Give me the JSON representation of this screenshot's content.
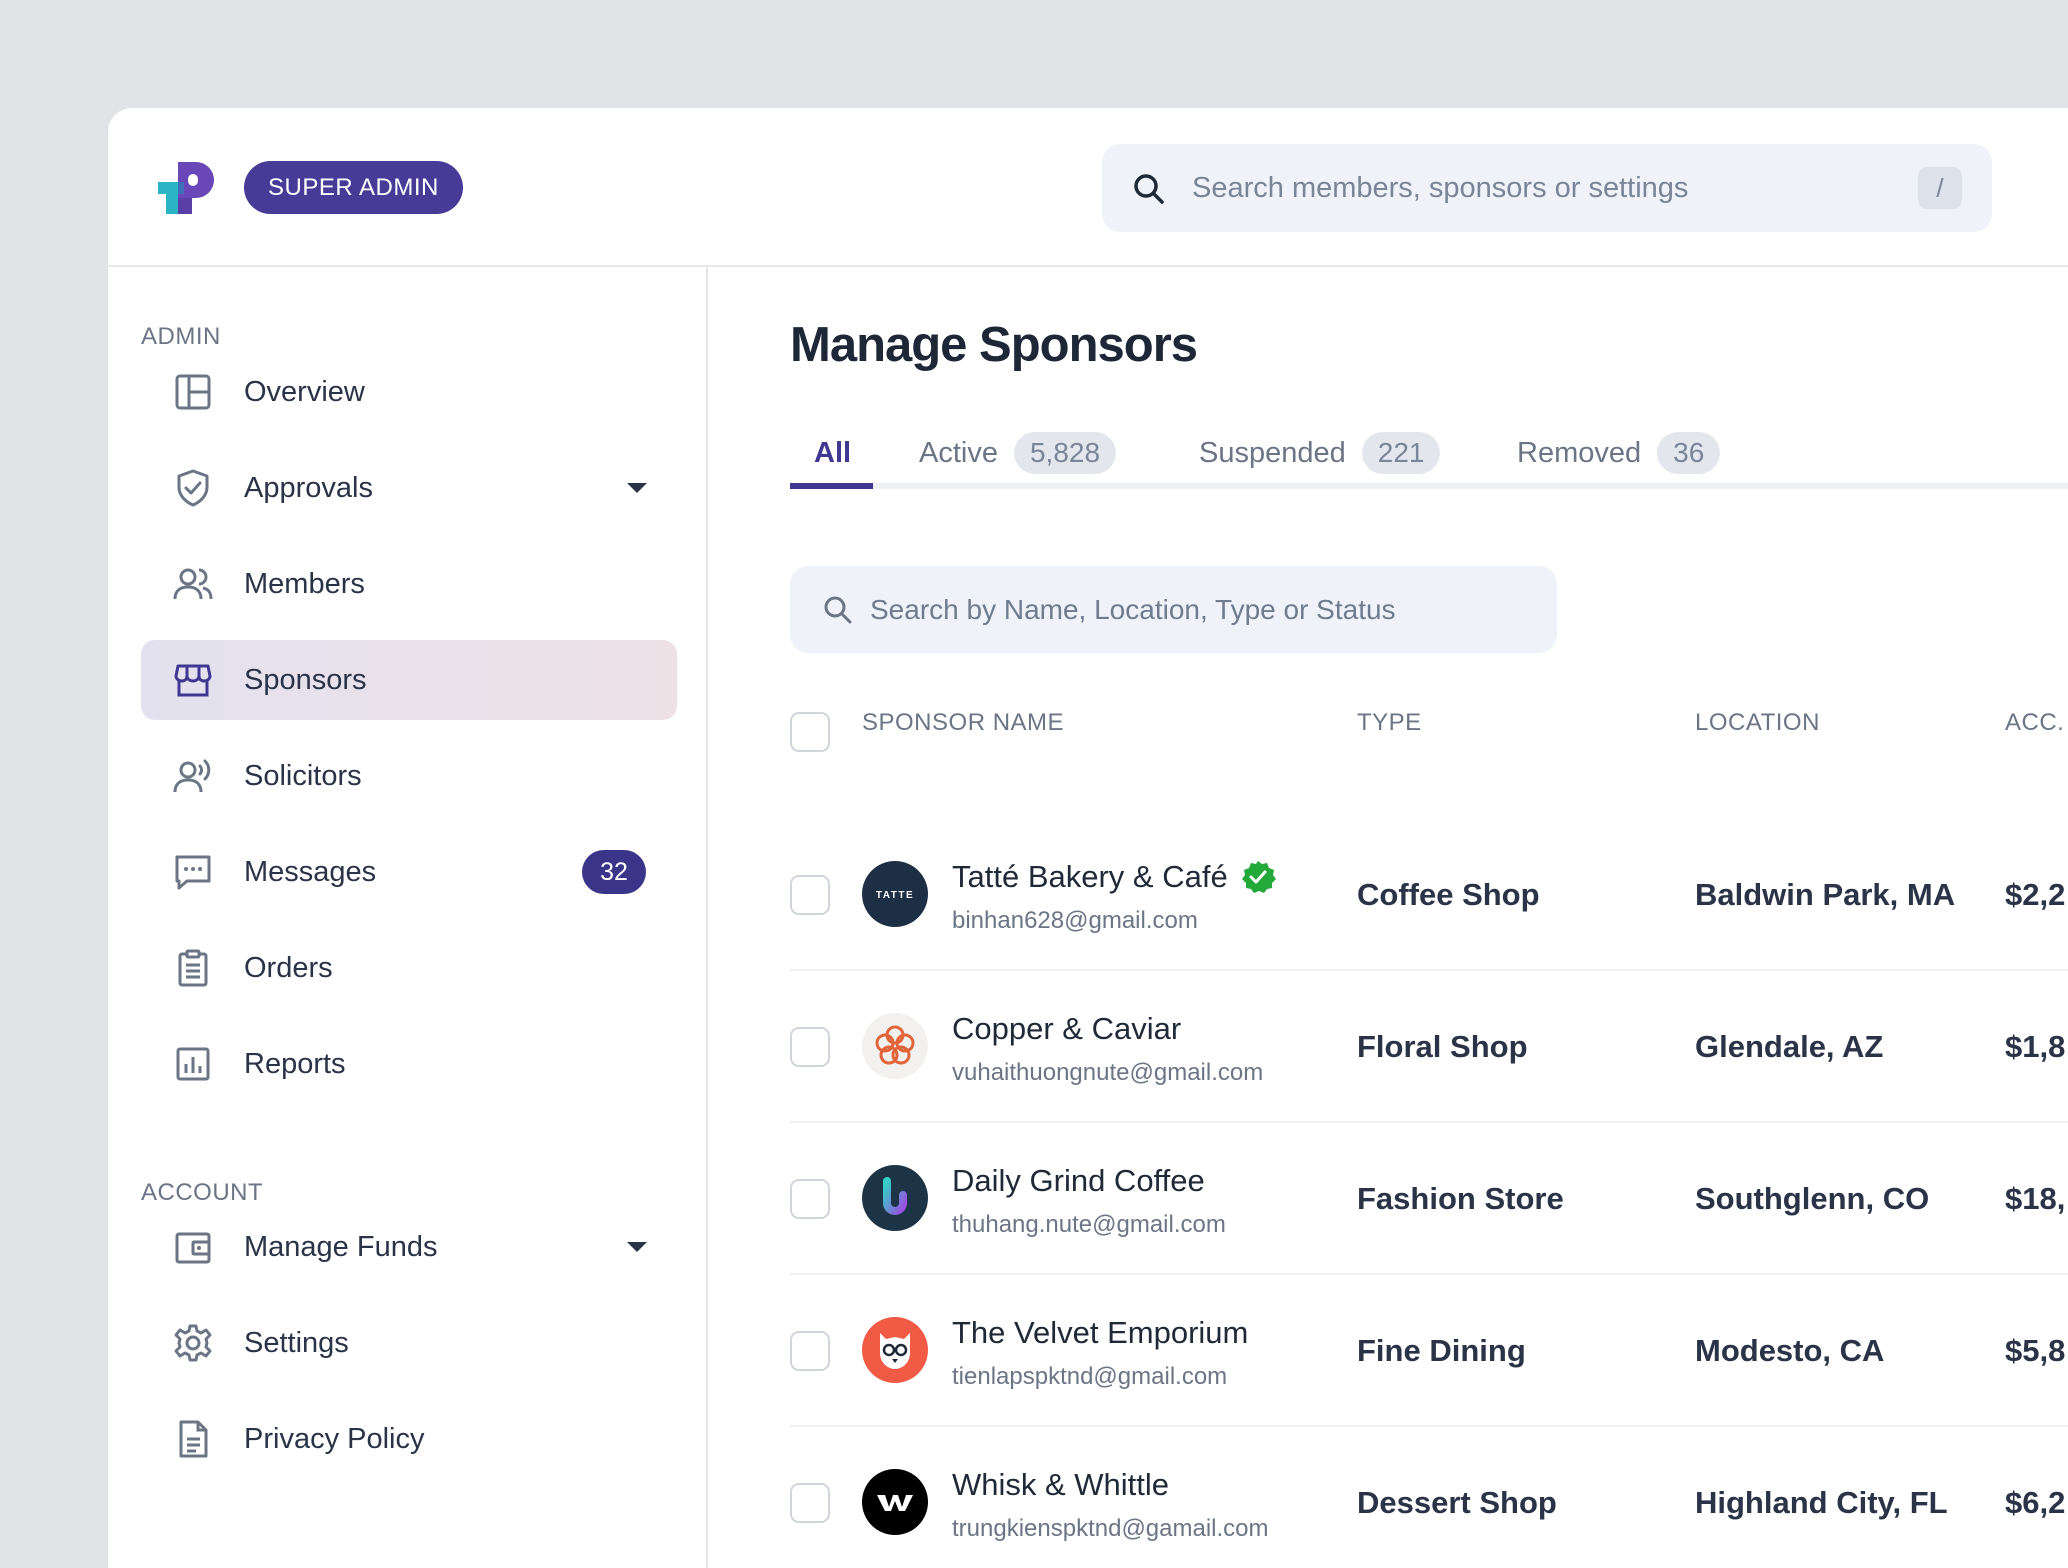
{
  "header": {
    "role_badge": "SUPER ADMIN",
    "search_placeholder": "Search members, sponsors or settings",
    "search_shortcut": "/"
  },
  "sidebar": {
    "admin_label": "ADMIN",
    "account_label": "ACCOUNT",
    "admin_items": [
      {
        "label": "Overview",
        "icon": "layout-icon"
      },
      {
        "label": "Approvals",
        "icon": "shield-check-icon"
      },
      {
        "label": "Members",
        "icon": "users-icon"
      },
      {
        "label": "Sponsors",
        "icon": "storefront-icon"
      },
      {
        "label": "Solicitors",
        "icon": "user-broadcast-icon"
      },
      {
        "label": "Messages",
        "icon": "message-icon",
        "badge": "32"
      },
      {
        "label": "Orders",
        "icon": "clipboard-icon"
      },
      {
        "label": "Reports",
        "icon": "bar-chart-icon"
      }
    ],
    "account_items": [
      {
        "label": "Manage Funds",
        "icon": "wallet-icon"
      },
      {
        "label": "Settings",
        "icon": "gear-icon"
      },
      {
        "label": "Privacy Policy",
        "icon": "document-icon"
      }
    ]
  },
  "main": {
    "title": "Manage Sponsors",
    "tabs": [
      {
        "label": "All"
      },
      {
        "label": "Active",
        "count": "5,828"
      },
      {
        "label": "Suspended",
        "count": "221"
      },
      {
        "label": "Removed",
        "count": "36"
      }
    ],
    "table_search_placeholder": "Search by Name, Location, Type or Status",
    "columns": [
      "SPONSOR NAME",
      "TYPE",
      "LOCATION",
      "ACC."
    ],
    "rows": [
      {
        "name": "Tatté Bakery & Café",
        "email": "binhan628@gmail.com",
        "type": "Coffee Shop",
        "location": "Baldwin Park, MA",
        "acc": "$2,2",
        "logo_text": "TATTE"
      },
      {
        "name": "Copper & Caviar",
        "email": "vuhaithuongnute@gmail.com",
        "type": "Floral Shop",
        "location": "Glendale, AZ",
        "acc": "$1,8"
      },
      {
        "name": "Daily Grind Coffee",
        "email": "thuhang.nute@gmail.com",
        "type": "Fashion Store",
        "location": "Southglenn, CO",
        "acc": "$18,"
      },
      {
        "name": "The Velvet Emporium",
        "email": "tienlapspktnd@gmail.com",
        "type": "Fine Dining",
        "location": "Modesto, CA",
        "acc": "$5,8"
      },
      {
        "name": "Whisk & Whittle",
        "email": "trungkienspktnd@gamail.com",
        "type": "Dessert Shop",
        "location": "Highland City, FL",
        "acc": "$6,2"
      }
    ]
  },
  "colors": {
    "brand": "#473b97",
    "accent_teal": "#2bb5c4",
    "verified": "#22a93a"
  }
}
